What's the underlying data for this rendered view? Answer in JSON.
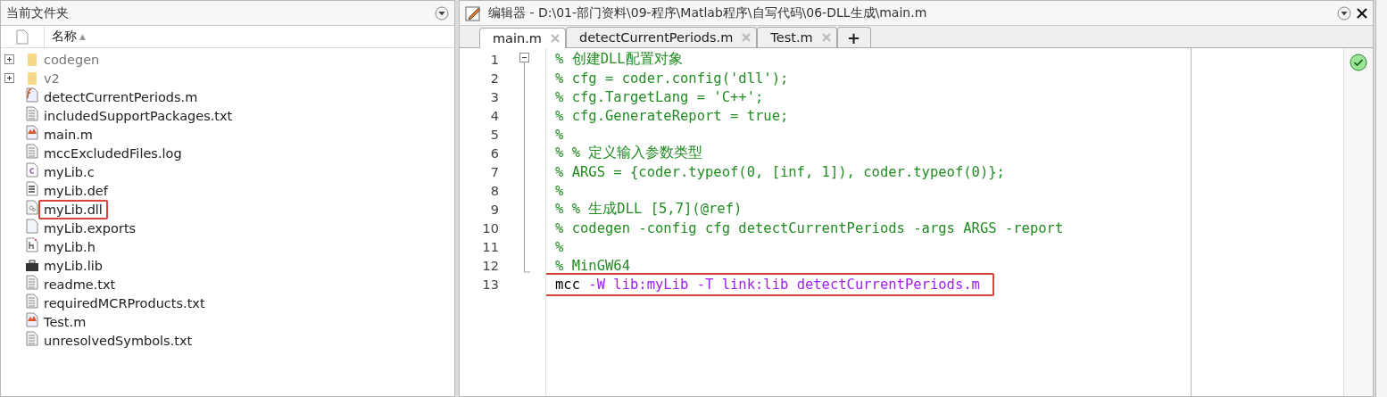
{
  "file_browser": {
    "title": "当前文件夹",
    "column": {
      "label": "名称",
      "sort_mark": "▲"
    },
    "items": [
      {
        "name": "codegen",
        "kind": "folder",
        "expanded": false,
        "highlighted": false
      },
      {
        "name": "v2",
        "kind": "folder",
        "expanded": false,
        "highlighted": false
      },
      {
        "name": "detectCurrentPeriods.m",
        "kind": "function",
        "highlighted": false
      },
      {
        "name": "includedSupportPackages.txt",
        "kind": "text",
        "highlighted": false
      },
      {
        "name": "main.m",
        "kind": "script",
        "highlighted": false
      },
      {
        "name": "mccExcludedFiles.log",
        "kind": "text",
        "highlighted": false
      },
      {
        "name": "myLib.c",
        "kind": "csource",
        "highlighted": false
      },
      {
        "name": "myLib.def",
        "kind": "doc",
        "highlighted": false
      },
      {
        "name": "myLib.dll",
        "kind": "library",
        "highlighted": true
      },
      {
        "name": "myLib.exports",
        "kind": "blank",
        "highlighted": false
      },
      {
        "name": "myLib.h",
        "kind": "header",
        "highlighted": false
      },
      {
        "name": "myLib.lib",
        "kind": "archive",
        "highlighted": false
      },
      {
        "name": "readme.txt",
        "kind": "text",
        "highlighted": false
      },
      {
        "name": "requiredMCRProducts.txt",
        "kind": "text",
        "highlighted": false
      },
      {
        "name": "Test.m",
        "kind": "script",
        "highlighted": false
      },
      {
        "name": "unresolvedSymbols.txt",
        "kind": "text",
        "highlighted": false
      }
    ]
  },
  "editor": {
    "title": "编辑器 - D:\\01-部门资料\\09-程序\\Matlab程序\\自写代码\\06-DLL生成\\main.m",
    "tabs": [
      {
        "label": "main.m",
        "selected": true
      },
      {
        "label": "detectCurrentPeriods.m",
        "selected": false
      },
      {
        "label": "Test.m",
        "selected": false
      }
    ],
    "new_tab": "+",
    "lines": [
      {
        "number": "1",
        "highlighted": false,
        "segments": [
          {
            "text": "% 创建DLL配置对象",
            "kind": "comment"
          }
        ]
      },
      {
        "number": "2",
        "highlighted": false,
        "segments": [
          {
            "text": "% cfg = coder.config('dll');",
            "kind": "comment"
          }
        ]
      },
      {
        "number": "3",
        "highlighted": false,
        "segments": [
          {
            "text": "% cfg.TargetLang = 'C++';",
            "kind": "comment"
          }
        ]
      },
      {
        "number": "4",
        "highlighted": false,
        "segments": [
          {
            "text": "% cfg.GenerateReport = true;",
            "kind": "comment"
          }
        ]
      },
      {
        "number": "5",
        "highlighted": false,
        "segments": [
          {
            "text": "%",
            "kind": "comment"
          }
        ]
      },
      {
        "number": "6",
        "highlighted": false,
        "segments": [
          {
            "text": "% % 定义输入参数类型",
            "kind": "comment"
          }
        ]
      },
      {
        "number": "7",
        "highlighted": false,
        "segments": [
          {
            "text": "% ARGS = {coder.typeof(0, [inf, 1]), coder.typeof(0)};",
            "kind": "comment"
          }
        ]
      },
      {
        "number": "8",
        "highlighted": false,
        "segments": [
          {
            "text": "%",
            "kind": "comment"
          }
        ]
      },
      {
        "number": "9",
        "highlighted": false,
        "segments": [
          {
            "text": "% % 生成DLL [5,7](@ref)",
            "kind": "comment"
          }
        ]
      },
      {
        "number": "10",
        "highlighted": false,
        "segments": [
          {
            "text": "% codegen -config cfg detectCurrentPeriods -args ARGS -report",
            "kind": "comment"
          }
        ]
      },
      {
        "number": "11",
        "highlighted": false,
        "segments": [
          {
            "text": "%",
            "kind": "comment"
          }
        ]
      },
      {
        "number": "12",
        "highlighted": false,
        "segments": [
          {
            "text": "% MinGW64",
            "kind": "comment"
          }
        ]
      },
      {
        "number": "13",
        "highlighted": true,
        "segments": [
          {
            "text": "mcc",
            "kind": "code"
          },
          {
            "text": " -W lib:myLib -T link:lib detectCurrentPeriods.m",
            "kind": "string"
          }
        ]
      }
    ]
  }
}
